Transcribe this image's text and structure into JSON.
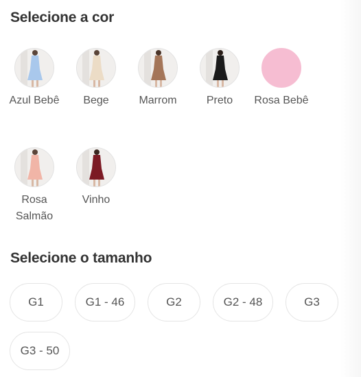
{
  "color_section": {
    "title": "Selecione a cor",
    "options": [
      {
        "label": "Azul Bebê",
        "color": "#a9c8ec"
      },
      {
        "label": "Bege",
        "color": "#ecdcc6"
      },
      {
        "label": "Marrom",
        "color": "#a47558"
      },
      {
        "label": "Preto",
        "color": "#1b1b1b"
      },
      {
        "label": "Rosa Bebê",
        "color": "#f6bdd2"
      },
      {
        "label": "Rosa Salmão",
        "color": "#f1b5a7"
      },
      {
        "label": "Vinho",
        "color": "#7c1a24"
      }
    ]
  },
  "size_section": {
    "title": "Selecione o tamanho",
    "options": [
      "G1",
      "G1 - 46",
      "G2",
      "G2 - 48",
      "G3",
      "G3 - 50"
    ]
  }
}
